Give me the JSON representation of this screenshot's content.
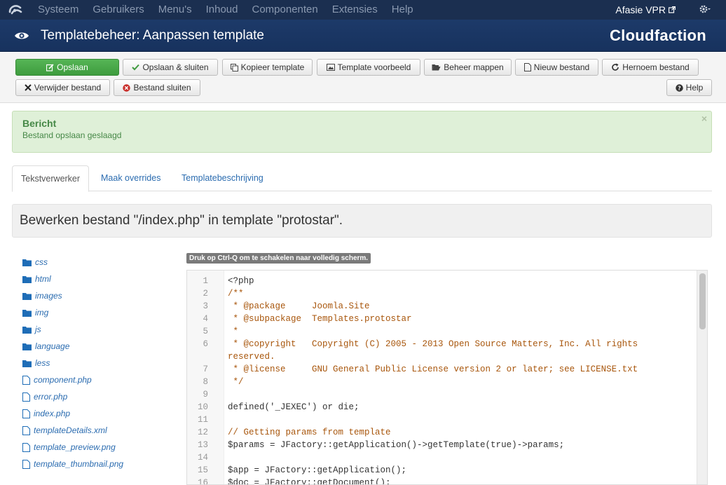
{
  "topnav": {
    "menu": [
      "Systeem",
      "Gebruikers",
      "Menu's",
      "Inhoud",
      "Componenten",
      "Extensies",
      "Help"
    ],
    "site_link": "Afasie VPR"
  },
  "header": {
    "title": "Templatebeheer: Aanpassen template",
    "brand": "Cloudfaction"
  },
  "toolbar": {
    "save": "Opslaan",
    "save_close": "Opslaan & sluiten",
    "copy": "Kopieer template",
    "preview": "Template voorbeeld",
    "manage_folders": "Beheer mappen",
    "new_file": "Nieuw bestand",
    "rename": "Hernoem bestand",
    "delete": "Verwijder bestand",
    "close_file": "Bestand sluiten",
    "help": "Help"
  },
  "message": {
    "heading": "Bericht",
    "text": "Bestand opslaan geslaagd",
    "close": "×"
  },
  "tabs": [
    "Tekstverwerker",
    "Maak overrides",
    "Templatebeschrijving"
  ],
  "file_header": "Bewerken bestand \"/index.php\" in template \"protostar\".",
  "tree": {
    "folders": [
      "css",
      "html",
      "images",
      "img",
      "js",
      "language",
      "less"
    ],
    "files": [
      "component.php",
      "error.php",
      "index.php",
      "templateDetails.xml",
      "template_preview.png",
      "template_thumbnail.png"
    ]
  },
  "editor_hint": "Druk op Ctrl-Q om te schakelen naar volledig scherm.",
  "code_lines": [
    {
      "n": "1",
      "t": "<?php"
    },
    {
      "n": "2",
      "t": "/**"
    },
    {
      "n": "3",
      "t": " * @package     Joomla.Site"
    },
    {
      "n": "4",
      "t": " * @subpackage  Templates.protostar"
    },
    {
      "n": "5",
      "t": " *"
    },
    {
      "n": "6",
      "t": " * @copyright   Copyright (C) 2005 - 2013 Open Source Matters, Inc. All rights"
    },
    {
      "n": "",
      "t": "reserved."
    },
    {
      "n": "7",
      "t": " * @license     GNU General Public License version 2 or later; see LICENSE.txt"
    },
    {
      "n": "8",
      "t": " */"
    },
    {
      "n": "9",
      "t": ""
    },
    {
      "n": "10",
      "t": "defined('_JEXEC') or die;"
    },
    {
      "n": "11",
      "t": ""
    },
    {
      "n": "12",
      "t": "// Getting params from template"
    },
    {
      "n": "13",
      "t": "$params = JFactory::getApplication()->getTemplate(true)->params;"
    },
    {
      "n": "14",
      "t": ""
    },
    {
      "n": "15",
      "t": "$app = JFactory::getApplication();"
    },
    {
      "n": "16",
      "t": "$doc = JFactory::getDocument();"
    }
  ]
}
